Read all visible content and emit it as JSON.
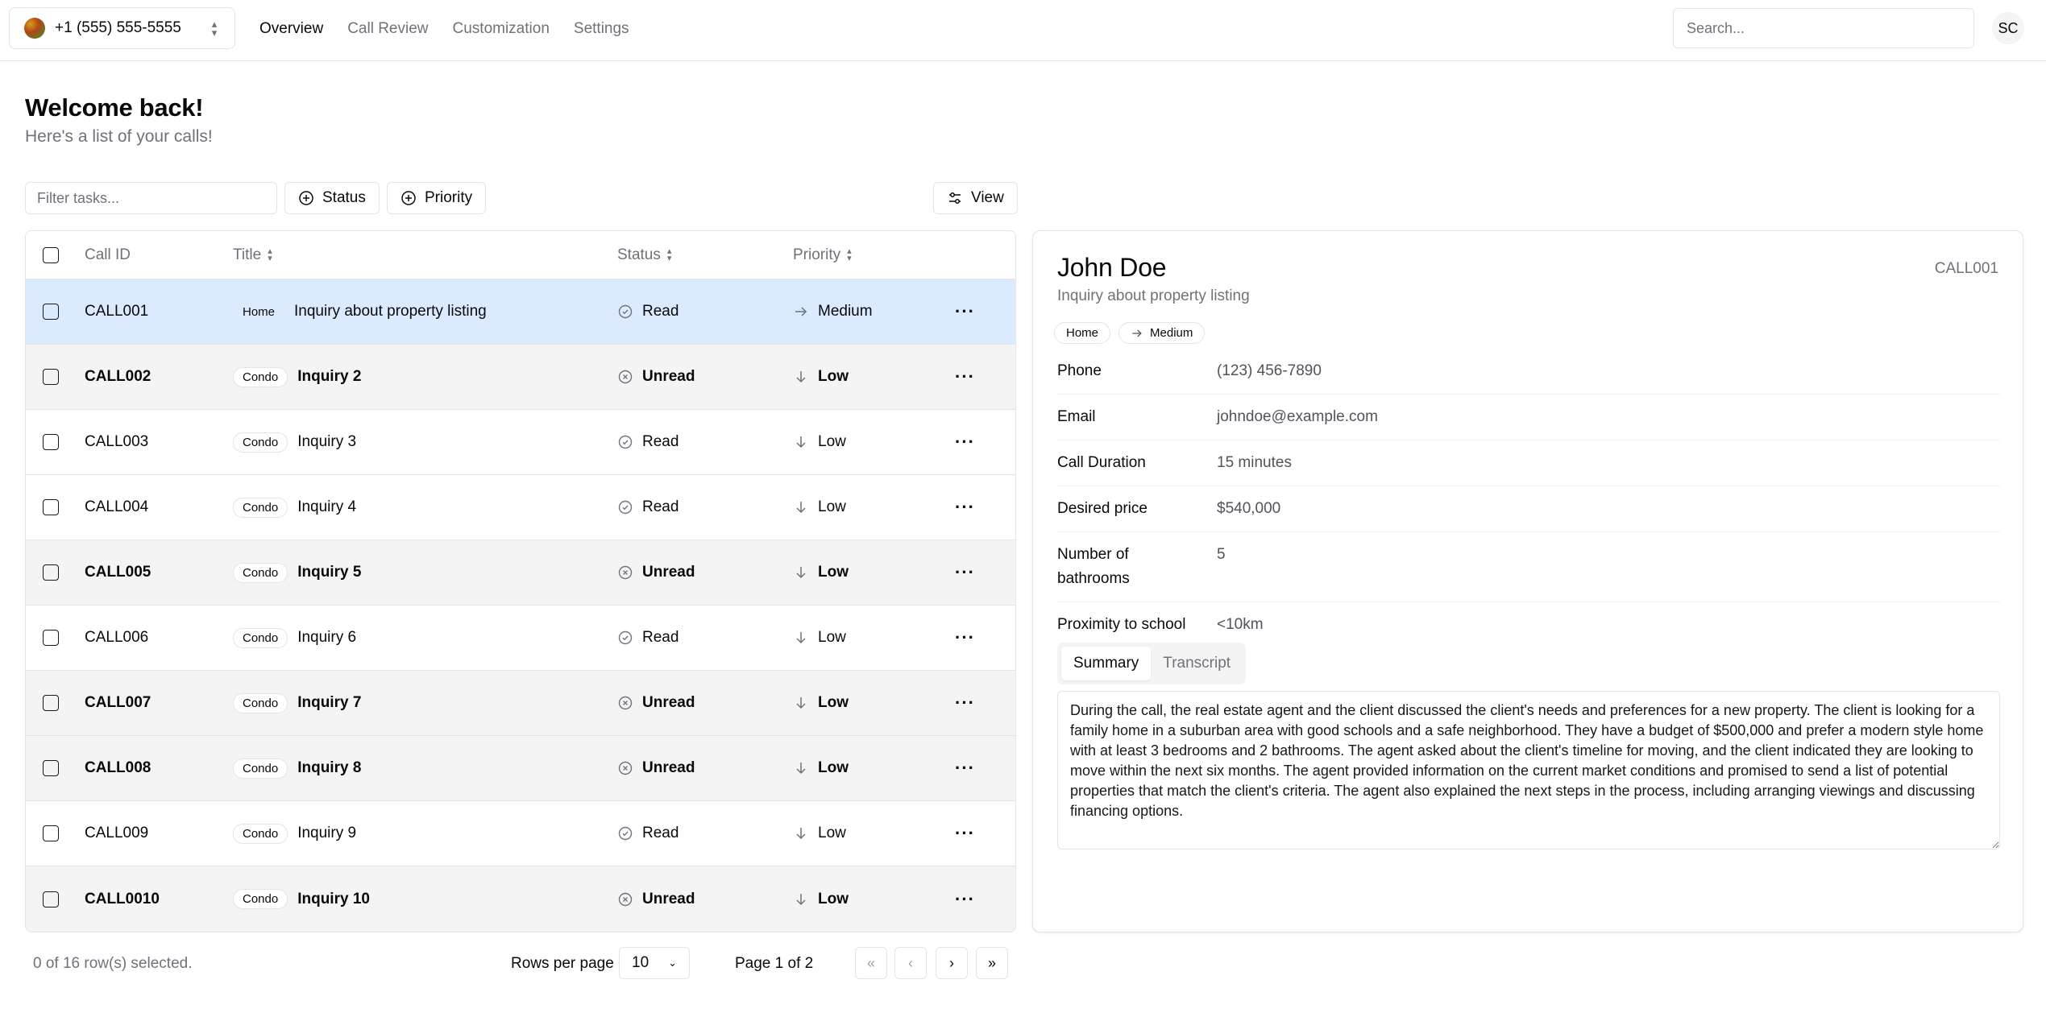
{
  "header": {
    "account_label": "+1 (555) 555-5555",
    "nav": [
      {
        "label": "Overview",
        "active": true
      },
      {
        "label": "Call Review",
        "active": false
      },
      {
        "label": "Customization",
        "active": false
      },
      {
        "label": "Settings",
        "active": false
      }
    ],
    "search_placeholder": "Search...",
    "avatar_initials": "SC"
  },
  "page": {
    "title": "Welcome back!",
    "subtitle": "Here's a list of your calls!"
  },
  "toolbar": {
    "filter_placeholder": "Filter tasks...",
    "status_label": "Status",
    "priority_label": "Priority",
    "view_label": "View"
  },
  "table": {
    "columns": {
      "call_id": "Call ID",
      "title": "Title",
      "status": "Status",
      "priority": "Priority"
    },
    "rows": [
      {
        "id": "CALL001",
        "tag": "Home",
        "title": "Inquiry about property listing",
        "status": "Read",
        "priority": "Medium",
        "state": "selected"
      },
      {
        "id": "CALL002",
        "tag": "Condo",
        "title": "Inquiry 2",
        "status": "Unread",
        "priority": "Low",
        "state": "unread"
      },
      {
        "id": "CALL003",
        "tag": "Condo",
        "title": "Inquiry 3",
        "status": "Read",
        "priority": "Low",
        "state": "read"
      },
      {
        "id": "CALL004",
        "tag": "Condo",
        "title": "Inquiry 4",
        "status": "Read",
        "priority": "Low",
        "state": "read"
      },
      {
        "id": "CALL005",
        "tag": "Condo",
        "title": "Inquiry 5",
        "status": "Unread",
        "priority": "Low",
        "state": "unread"
      },
      {
        "id": "CALL006",
        "tag": "Condo",
        "title": "Inquiry 6",
        "status": "Read",
        "priority": "Low",
        "state": "read"
      },
      {
        "id": "CALL007",
        "tag": "Condo",
        "title": "Inquiry 7",
        "status": "Unread",
        "priority": "Low",
        "state": "unread"
      },
      {
        "id": "CALL008",
        "tag": "Condo",
        "title": "Inquiry 8",
        "status": "Unread",
        "priority": "Low",
        "state": "unread"
      },
      {
        "id": "CALL009",
        "tag": "Condo",
        "title": "Inquiry 9",
        "status": "Read",
        "priority": "Low",
        "state": "read"
      },
      {
        "id": "CALL0010",
        "tag": "Condo",
        "title": "Inquiry 10",
        "status": "Unread",
        "priority": "Low",
        "state": "unread"
      }
    ]
  },
  "footer": {
    "selection": "0 of 16 row(s) selected.",
    "rows_per_page_label": "Rows per page",
    "rows_per_page_value": "10",
    "page_info": "Page 1 of 2"
  },
  "detail": {
    "name": "John Doe",
    "call_id": "CALL001",
    "subtitle": "Inquiry about property listing",
    "tag": "Home",
    "priority": "Medium",
    "fields": [
      {
        "key": "Phone",
        "value": "(123) 456-7890"
      },
      {
        "key": "Email",
        "value": "johndoe@example.com"
      },
      {
        "key": "Call Duration",
        "value": "15 minutes"
      },
      {
        "key": "Desired price",
        "value": "$540,000"
      },
      {
        "key": "Number of bathrooms",
        "value": "5"
      },
      {
        "key": "Proximity to school",
        "value": "<10km"
      }
    ],
    "tabs": [
      {
        "label": "Summary",
        "active": true
      },
      {
        "label": "Transcript",
        "active": false
      }
    ],
    "summary": "During the call, the real estate agent and the client discussed the client's needs and preferences for a new property. The client is looking for a family home in a suburban area with good schools and a safe neighborhood. They have a budget of $500,000 and prefer a modern style home with at least 3 bedrooms and 2 bathrooms. The agent asked about the client's timeline for moving, and the client indicated they are looking to move within the next six months. The agent provided information on the current market conditions and promised to send a list of potential properties that match the client's criteria. The agent also explained the next steps in the process, including arranging viewings and discussing financing options."
  },
  "colors": {
    "selected_row": "#dbeafe",
    "unread_row": "#f4f4f5",
    "border": "#e4e4e7",
    "muted_text": "#71717a"
  }
}
